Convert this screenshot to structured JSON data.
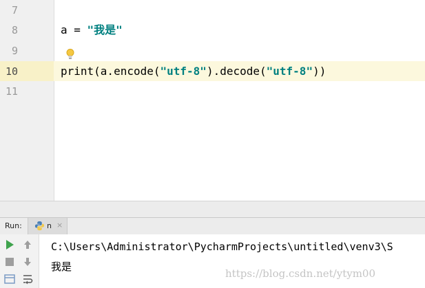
{
  "editor": {
    "lines": [
      {
        "number": "7",
        "code": ""
      },
      {
        "number": "8",
        "code_parts": [
          "a = ",
          "\"我是\""
        ]
      },
      {
        "number": "9",
        "code": ""
      },
      {
        "number": "10",
        "code_parts": [
          "print(a.encode(",
          "\"utf-8\"",
          ").decode(",
          "\"utf-8\"",
          "))"
        ]
      },
      {
        "number": "11",
        "code": ""
      }
    ],
    "active_line": "10",
    "colors": {
      "string": "#008080",
      "caret_row": "#fcf8dd",
      "gutter": "#f0f0f0"
    }
  },
  "run_panel": {
    "label": "Run:",
    "tab": {
      "name": "n",
      "icon": "python-icon",
      "close_glyph": "×"
    },
    "toolbar": [
      "run-icon",
      "scroll-up-icon",
      "stop-icon",
      "scroll-down-icon",
      "layout-icon",
      "soft-wrap-icon"
    ],
    "output": {
      "path_line": "C:\\Users\\Administrator\\PycharmProjects\\untitled\\venv3\\S",
      "result_line": "我是"
    }
  },
  "watermark": "https://blog.csdn.net/ytym00"
}
